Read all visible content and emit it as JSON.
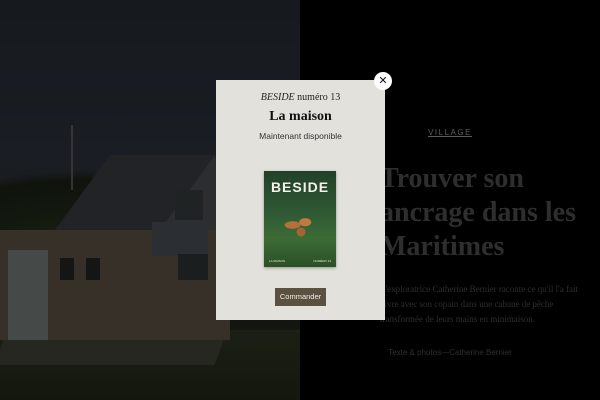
{
  "article": {
    "kicker": "VILLAGE",
    "headline": "Trouver son ancrage dans les Maritimes",
    "lede": "L'exploratrice Catherine Bernier raconte ce qu'il l'a fait vivre avec son copain dans une cabane de pêche transformée de leurs mains en minimaison.",
    "credit": "Texte & photos—Catherine Bernier"
  },
  "modal": {
    "brand": "BESIDE",
    "issue": "numéro 13",
    "title": "La maison",
    "subtitle": "Maintenant disponible",
    "cover": {
      "title": "BESIDE",
      "foot_left": "LA MAISON",
      "foot_right": "NUMÉRO 13"
    },
    "order_label": "Commander",
    "close_label": "✕"
  },
  "colors": {
    "modal_bg": "#e3e1db",
    "button_bg": "#5b5140",
    "page_bg": "#000000"
  }
}
